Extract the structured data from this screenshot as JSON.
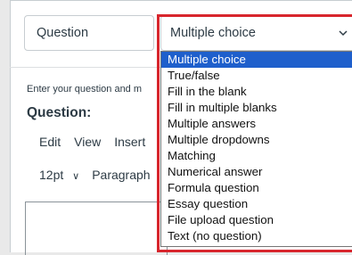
{
  "question_form": {
    "title_field": "Question",
    "type_select": {
      "selected": "Multiple choice",
      "options": [
        "Multiple choice",
        "True/false",
        "Fill in the blank",
        "Fill in multiple blanks",
        "Multiple answers",
        "Multiple dropdowns",
        "Matching",
        "Numerical answer",
        "Formula question",
        "Essay question",
        "File upload question",
        "Text (no question)"
      ]
    },
    "instructions": "Enter your question and m",
    "question_label": "Question:"
  },
  "editor": {
    "menu": [
      "Edit",
      "View",
      "Insert"
    ],
    "font_size": "12pt",
    "block_format": "Paragraph"
  },
  "icons": {
    "select_chevron": "chevron-down-icon",
    "font_size_chevron": "chevron-down-icon"
  },
  "colors": {
    "highlight_frame": "#d8262d",
    "selected_option_bg": "#1e5fcc"
  }
}
